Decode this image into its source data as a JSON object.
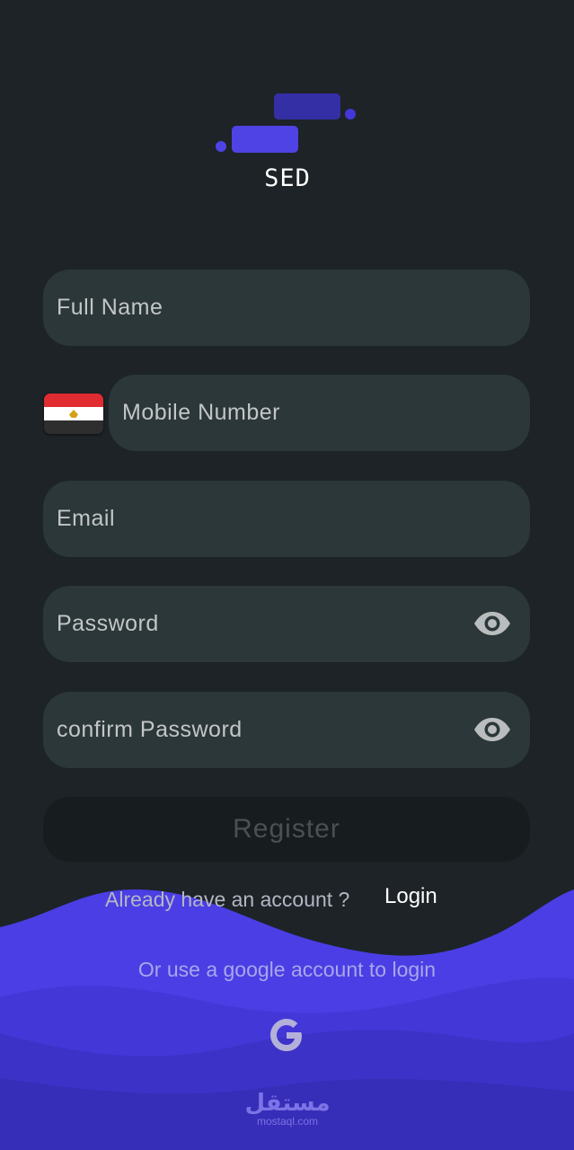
{
  "brand": {
    "name": "SED"
  },
  "form": {
    "full_name_placeholder": "Full Name",
    "mobile_placeholder": "Mobile Number",
    "email_placeholder": "Email",
    "password_placeholder": "Password",
    "confirm_password_placeholder": "confirm Password",
    "register_label": "Register"
  },
  "auth": {
    "already_text": "Already have an account ?",
    "login_label": "Login",
    "google_text": "Or use a google account to login",
    "google_icon": "google-g-icon"
  },
  "watermark": {
    "arabic": "مستقل",
    "latin": "mostaql.com"
  },
  "colors": {
    "background": "#1d2327",
    "field": "#2b3739",
    "accent": "#4f43e6",
    "wave_light": "#4a3ee4",
    "wave_dark": "#3a30c0"
  }
}
